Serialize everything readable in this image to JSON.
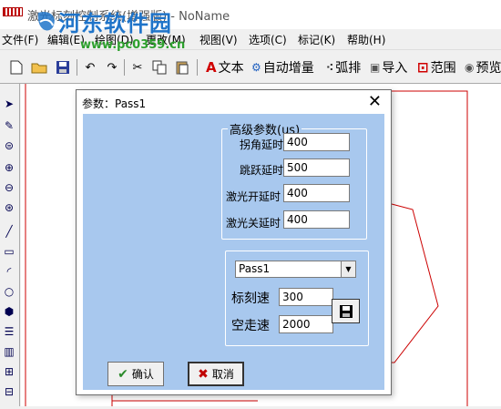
{
  "window": {
    "title": "激光标刻控制系统(增强版) - NoName"
  },
  "watermark": {
    "text": "河东软件园",
    "url": "www.pc0359.cn"
  },
  "menu": [
    "文件(F)",
    "编辑(E)",
    "绘图(D)",
    "更改(M)",
    "视图(V)",
    "选项(C)",
    "标记(K)",
    "帮助(H)"
  ],
  "toolbar": {
    "text_label": "文本",
    "auto_increment_label": "自动增量",
    "arc_label": "弧排",
    "import_label": "导入",
    "range_label": "范围",
    "preview_label": "预览"
  },
  "dialog": {
    "title": "参数：Pass1",
    "advanced_legend": "高级参数(us)",
    "corner_delay_label": "拐角延时",
    "corner_delay_value": "400",
    "jump_delay_label": "跳跃延时",
    "jump_delay_value": "500",
    "laser_on_delay_label": "激光开延时",
    "laser_on_delay_value": "400",
    "laser_off_delay_label": "激光关延时",
    "laser_off_delay_value": "400",
    "pass_select_value": "Pass1",
    "mark_speed_label": "标刻速",
    "mark_speed_value": "300",
    "jump_speed_label": "空走速",
    "jump_speed_value": "2000",
    "ok_label": "确认",
    "cancel_label": "取消"
  },
  "colors": {
    "dialog_body": "#a8c8ee",
    "canvas_lines": "#cc0000",
    "ok_check": "#2a8a2a",
    "cancel_x": "#c00000"
  }
}
